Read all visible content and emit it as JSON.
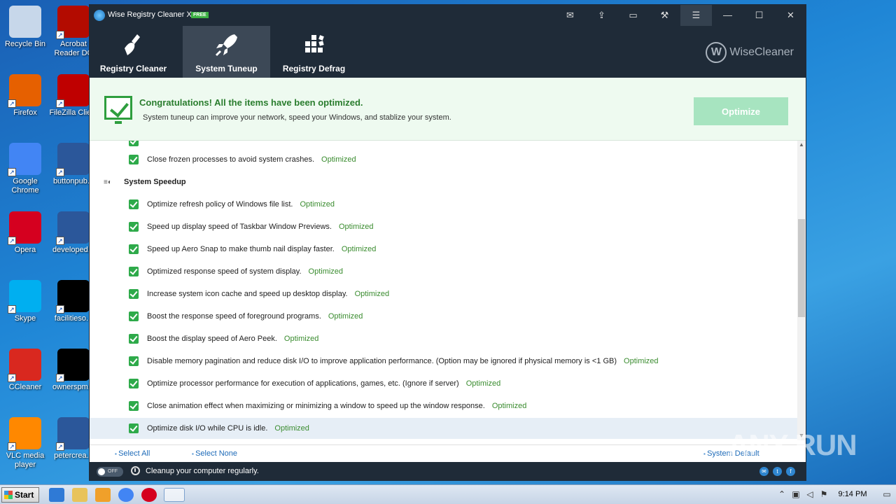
{
  "desktop": {
    "icons": [
      {
        "label": "Recycle Bin",
        "icon": "recycle-bin-icon",
        "color": "#c7d7ea"
      },
      {
        "label": "Acrobat Reader DC",
        "icon": "acrobat-icon",
        "color": "#b30b00"
      },
      {
        "label": "Firefox",
        "icon": "firefox-icon",
        "color": "#e66000"
      },
      {
        "label": "FileZilla Client",
        "icon": "filezilla-icon",
        "color": "#bf0000"
      },
      {
        "label": "Google Chrome",
        "icon": "chrome-icon",
        "color": "#4285f4"
      },
      {
        "label": "buttonpub...",
        "icon": "word-doc-icon",
        "color": "#2b579a"
      },
      {
        "label": "Opera",
        "icon": "opera-icon",
        "color": "#d5001f"
      },
      {
        "label": "developed...",
        "icon": "word-doc-icon",
        "color": "#2b579a"
      },
      {
        "label": "Skype",
        "icon": "skype-icon",
        "color": "#00aff0"
      },
      {
        "label": "facilitieso...",
        "icon": "black-file-icon",
        "color": "#000000"
      },
      {
        "label": "CCleaner",
        "icon": "ccleaner-icon",
        "color": "#d9281f"
      },
      {
        "label": "ownerspm...",
        "icon": "black-file-icon",
        "color": "#000000"
      },
      {
        "label": "VLC media player",
        "icon": "vlc-icon",
        "color": "#ff8800"
      },
      {
        "label": "petercrea...",
        "icon": "word-doc-icon",
        "color": "#2b579a"
      }
    ]
  },
  "window": {
    "title": "Wise Registry Cleaner X",
    "badge": "FREE",
    "brand": "WiseCleaner",
    "tabs": [
      {
        "label": "Registry Cleaner",
        "icon": "broom-icon"
      },
      {
        "label": "System Tuneup",
        "icon": "rocket-icon"
      },
      {
        "label": "Registry Defrag",
        "icon": "defrag-blocks-icon"
      }
    ],
    "banner": {
      "heading": "Congratulations! All the items have been optimized.",
      "subtext": "System tuneup can improve your network, speed your Windows, and stablize your system.",
      "button": "Optimize"
    },
    "top_item": {
      "text": "Close frozen processes to avoid system crashes.",
      "status": "Optimized"
    },
    "section": {
      "title": "System Speedup"
    },
    "items": [
      {
        "text": "Optimize refresh policy of Windows file list.",
        "status": "Optimized"
      },
      {
        "text": "Speed up display speed of Taskbar Window Previews.",
        "status": "Optimized"
      },
      {
        "text": "Speed up Aero Snap to make thumb nail display faster.",
        "status": "Optimized"
      },
      {
        "text": "Optimized response speed of system display.",
        "status": "Optimized"
      },
      {
        "text": "Increase system icon cache and speed up desktop display.",
        "status": "Optimized"
      },
      {
        "text": "Boost the response speed of foreground programs.",
        "status": "Optimized"
      },
      {
        "text": "Boost the display speed of Aero Peek.",
        "status": "Optimized"
      },
      {
        "text": "Disable memory pagination and reduce disk I/O to improve application performance. (Option may be ignored if physical memory is <1 GB)",
        "status": "Optimized"
      },
      {
        "text": "Optimize processor performance for execution of applications, games, etc. (Ignore if server)",
        "status": "Optimized"
      },
      {
        "text": "Close animation effect when maximizing or minimizing a window to speed up the window response.",
        "status": "Optimized"
      },
      {
        "text": "Optimize disk I/O while CPU is idle.",
        "status": "Optimized"
      }
    ],
    "footer": {
      "select_all": "Select All",
      "select_none": "Select None",
      "system_default": "System Default"
    },
    "statusbar": {
      "toggle": "OFF",
      "text": "Cleanup your computer regularly."
    }
  },
  "taskbar": {
    "start": "Start",
    "clock": "9:14 PM"
  },
  "watermark": "ANY RUN",
  "colors": {
    "dark": "#1f2b38",
    "green": "#2eaa4a",
    "status_green": "#3a8c2f",
    "link_blue": "#1e6bb8"
  }
}
